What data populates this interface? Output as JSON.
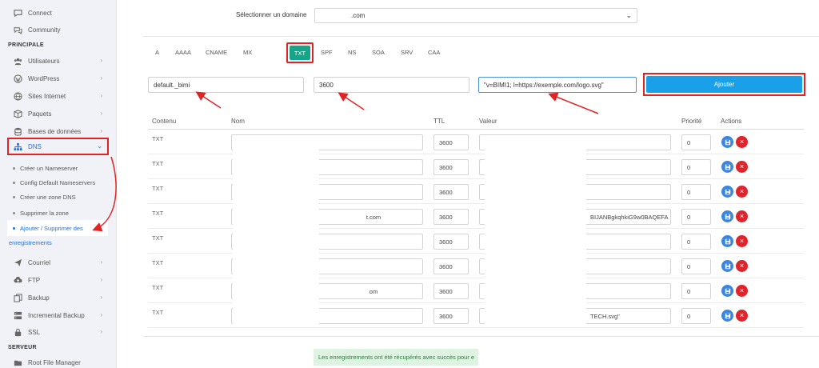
{
  "sidebar": {
    "top_items": [
      {
        "label": "Connect",
        "icon": "chat-icon"
      },
      {
        "label": "Community",
        "icon": "community-icon"
      }
    ],
    "section_principale": "PRINCIPALE",
    "main_items": [
      {
        "label": "Utilisateurs",
        "icon": "users-icon"
      },
      {
        "label": "WordPress",
        "icon": "wordpress-icon"
      },
      {
        "label": "Sites Internet",
        "icon": "globe-icon"
      },
      {
        "label": "Paquets",
        "icon": "package-icon"
      },
      {
        "label": "Bases de données",
        "icon": "database-icon"
      },
      {
        "label": "DNS",
        "icon": "network-icon"
      }
    ],
    "dns_sub_items": [
      "Créer un Nameserver",
      "Config Default Nameservers",
      "Créer une zone DNS",
      "Supprimer la zone",
      "Ajouter / Supprimer des",
      "enregistrements"
    ],
    "more_items": [
      {
        "label": "Courriel",
        "icon": "send-icon"
      },
      {
        "label": "FTP",
        "icon": "cloud-upload-icon"
      },
      {
        "label": "Backup",
        "icon": "copy-icon"
      },
      {
        "label": "Incremental Backup",
        "icon": "server-icon"
      },
      {
        "label": "SSL",
        "icon": "lock-icon"
      }
    ],
    "section_serveur": "SERVEUR",
    "bottom_items": [
      {
        "label": "Root File Manager",
        "icon": "folder-icon"
      }
    ]
  },
  "domain": {
    "label": "Sélectionner un domaine",
    "value": ".com"
  },
  "tabs": [
    "A",
    "AAAA",
    "CNAME",
    "MX",
    "TXT",
    "SPF",
    "NS",
    "SOA",
    "SRV",
    "CAA"
  ],
  "active_tab": "TXT",
  "form": {
    "name_value": "default._bimi",
    "ttl_value": "3600",
    "value_value": "\"v=BIMI1; l=https://exemple.com/logo.svg\"",
    "add_label": "Ajouter"
  },
  "table": {
    "headers": [
      "Contenu",
      "Nom",
      "TTL",
      "Valeur",
      "Priorité",
      "Actions"
    ],
    "rows": [
      {
        "type": "TXT",
        "name": "",
        "ttl": "3600",
        "value": "",
        "priority": "0"
      },
      {
        "type": "TXT",
        "name": "",
        "ttl": "3600",
        "value": "",
        "priority": "0"
      },
      {
        "type": "TXT",
        "name": "",
        "ttl": "3600",
        "value": "",
        "priority": "0"
      },
      {
        "type": "TXT",
        "name": "t.com",
        "ttl": "3600",
        "value": "BIJANBgkqhkiG9w0BAQEFA",
        "priority": "0"
      },
      {
        "type": "TXT",
        "name": "",
        "ttl": "3600",
        "value": "",
        "priority": "0"
      },
      {
        "type": "TXT",
        "name": "",
        "ttl": "3600",
        "value": "",
        "priority": "0"
      },
      {
        "type": "TXT",
        "name": "om",
        "ttl": "3600",
        "value": "",
        "priority": "0"
      },
      {
        "type": "TXT",
        "name": "",
        "ttl": "3600",
        "value": "TECH.svg\"",
        "priority": "0"
      }
    ]
  },
  "success_message": "Les enregistrements ont été récupérés avec succès pour e",
  "colors": {
    "accent_green": "#17a589",
    "primary_blue": "#1aa0e8",
    "annotation_red": "#e02424",
    "sidebar_bg": "#f1f2f7"
  }
}
